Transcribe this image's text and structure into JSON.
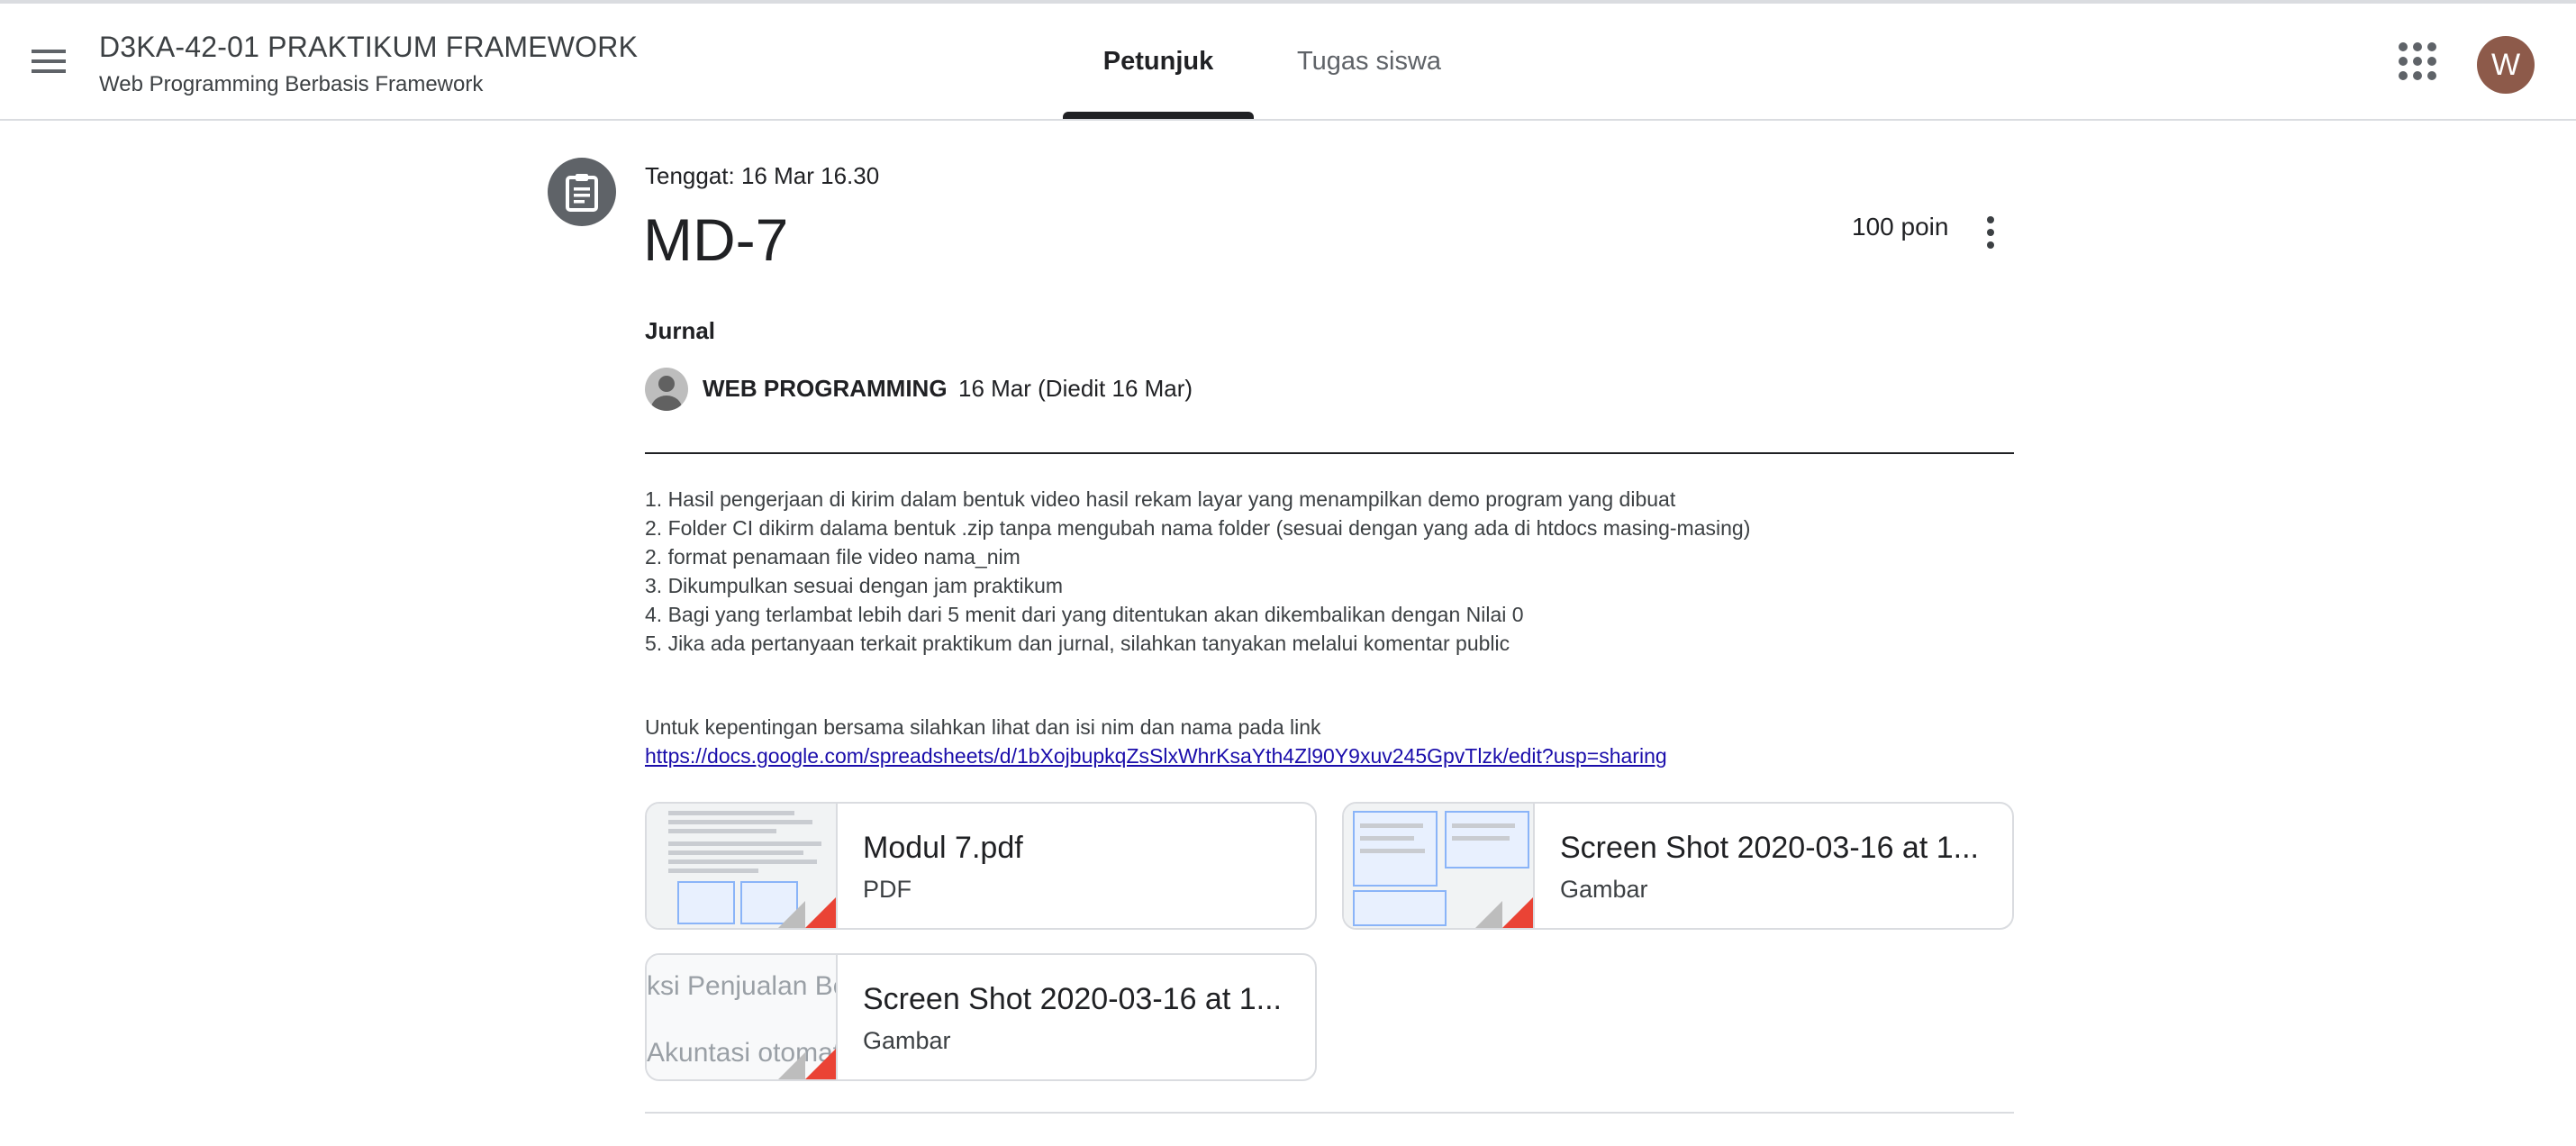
{
  "header": {
    "course_title": "D3KA-42-01 PRAKTIKUM FRAMEWORK",
    "course_subtitle": "Web Programming Berbasis Framework",
    "tabs": [
      {
        "label": "Petunjuk",
        "active": true
      },
      {
        "label": "Tugas siswa",
        "active": false
      }
    ],
    "avatar_initial": "W",
    "avatar_color": "#8d5a4a"
  },
  "assignment": {
    "due": "Tenggat: 16 Mar 16.30",
    "title": "MD-7",
    "points": "100 poin",
    "topic": "Jurnal",
    "author": "WEB PROGRAMMING",
    "date": "16 Mar (Diedit 16 Mar)",
    "instructions": [
      "1. Hasil pengerjaan di kirim dalam bentuk video hasil rekam layar yang menampilkan demo program yang dibuat",
      "2. Folder CI dikirm dalama bentuk .zip tanpa mengubah nama folder (sesuai dengan yang ada di htdocs masing-masing)",
      "2. format penamaan file video nama_nim",
      "3. Dikumpulkan sesuai dengan jam praktikum",
      "4. Bagi yang terlambat lebih dari 5 menit dari yang ditentukan akan dikembalikan dengan Nilai 0",
      "5. Jika ada pertanyaan terkait praktikum dan jurnal, silahkan tanyakan melalui komentar public"
    ],
    "note": "Untuk kepentingan bersama silahkan lihat dan isi nim dan nama pada link",
    "link": "https://docs.google.com/spreadsheets/d/1bXojbupkqZsSlxWhrKsaYth4Zl90Y9xuv245GpvTlzk/edit?usp=sharing"
  },
  "attachments": [
    {
      "title": "Modul 7.pdf",
      "type": "PDF"
    },
    {
      "title": "Screen Shot 2020-03-16 at 1...",
      "type": "Gambar"
    },
    {
      "title": "Screen Shot 2020-03-16 at 1...",
      "type": "Gambar",
      "thumb_text_1": "ksi Penjualan Be",
      "thumb_text_2": "Akuntasi otomat"
    }
  ],
  "icons": {
    "menu": "hamburger-menu-icon",
    "apps": "apps-grid-icon",
    "assignment": "assignment-clipboard-icon",
    "more": "more-vert-icon",
    "file_fold": "file-corner-fold-icon"
  }
}
